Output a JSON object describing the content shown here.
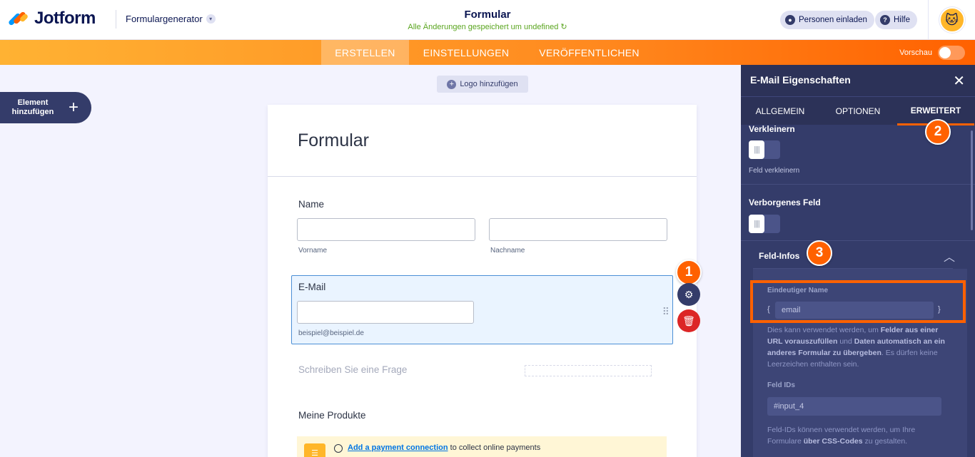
{
  "header": {
    "brand": "Jotform",
    "generator_label": "Formulargenerator",
    "form_title": "Formular",
    "save_status": "Alle Änderungen gespeichert um undefined",
    "invite_label": "Personen einladen",
    "help_label": "Hilfe"
  },
  "nav": {
    "tabs": [
      {
        "label": "ERSTELLEN",
        "active": true
      },
      {
        "label": "EINSTELLUNGEN",
        "active": false
      },
      {
        "label": "VERÖFFENTLICHEN",
        "active": false
      }
    ],
    "preview_label": "Vorschau"
  },
  "left": {
    "add_element_label": "Element hinzufügen"
  },
  "canvas": {
    "logo_label": "Logo hinzufügen",
    "form_heading": "Formular",
    "name_label": "Name",
    "first_name_sub": "Vorname",
    "last_name_sub": "Nachname",
    "email_label": "E-Mail",
    "email_sub": "beispiel@beispiel.de",
    "ask_placeholder": "Schreiben Sie eine Frage",
    "products_label": "Meine Produkte",
    "payment_link": "Add a payment connection",
    "payment_text": " to collect online payments"
  },
  "badges": {
    "one": "1",
    "two": "2",
    "three": "3"
  },
  "panel": {
    "title": "E-Mail Eigenschaften",
    "tabs": [
      {
        "label": "ALLGEMEIN",
        "active": false
      },
      {
        "label": "OPTIONEN",
        "active": false
      },
      {
        "label": "ERWEITERT",
        "active": true
      }
    ],
    "shrink_title": "Verkleinern",
    "shrink_desc": "Feld verkleinern",
    "hidden_title": "Verborgenes Feld",
    "field_info_title": "Feld-Infos",
    "unique_name_label": "Eindeutiger Name",
    "unique_name_value": "email",
    "unique_name_desc_1": "Dies kann verwendet werden, um ",
    "unique_name_desc_b1": "Felder aus einer URL vorauszufüllen",
    "unique_name_desc_2": " und ",
    "unique_name_desc_b2": "Daten automatisch an ein anderes Formular zu übergeben",
    "unique_name_desc_3": ". Es dürfen keine Leerzeichen enthalten sein.",
    "field_ids_label": "Feld IDs",
    "field_ids_value": "#input_4",
    "field_ids_desc_1": "Feld-IDs können verwendet werden, um Ihre Formulare ",
    "field_ids_desc_b": "über CSS-Codes",
    "field_ids_desc_2": " zu gestalten."
  },
  "colors": {
    "accent": "#ff6100",
    "panel": "#343c6a",
    "brand_blue": "#0a1551"
  }
}
